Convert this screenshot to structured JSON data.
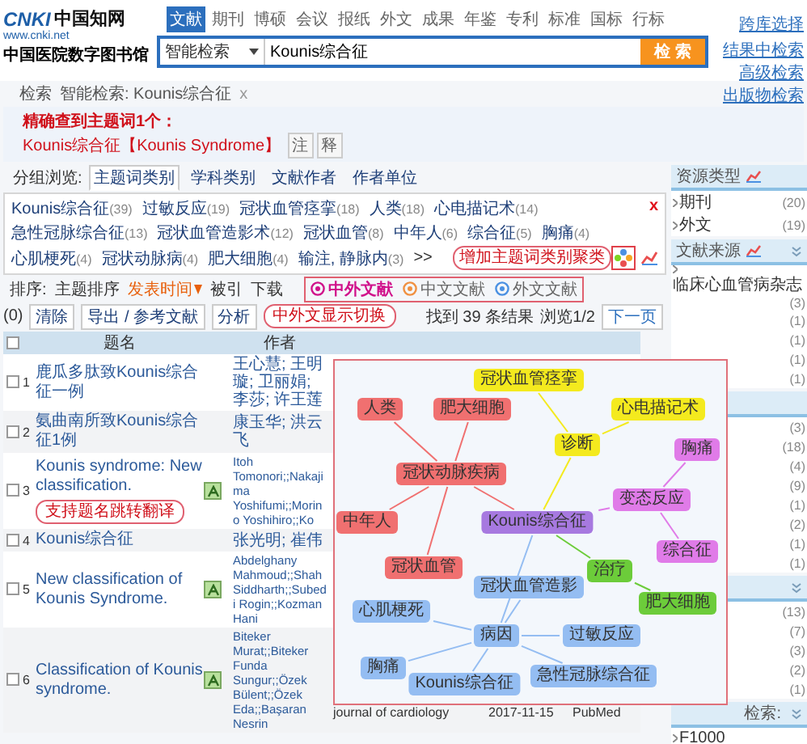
{
  "header": {
    "logo": {
      "mark": "CNKI",
      "name": "中国知网",
      "url": "www.cnki.net",
      "library": "中国医院数字图书馆"
    },
    "nav_tabs": [
      {
        "label": "文献",
        "selected": true
      },
      {
        "label": "期刊",
        "selected": false
      },
      {
        "label": "博硕",
        "selected": false
      },
      {
        "label": "会议",
        "selected": false
      },
      {
        "label": "报纸",
        "selected": false
      },
      {
        "label": "外文",
        "selected": false
      },
      {
        "label": "成果",
        "selected": false
      },
      {
        "label": "年鉴",
        "selected": false
      },
      {
        "label": "专利",
        "selected": false
      },
      {
        "label": "标准",
        "selected": false
      },
      {
        "label": "国标",
        "selected": false
      },
      {
        "label": "行标",
        "selected": false
      }
    ],
    "cross_db_link": "跨库选择",
    "search": {
      "mode": "智能检索",
      "value": "Kounis综合征",
      "button": "检 索"
    },
    "links": [
      "结果中检索",
      "高级检索",
      "出版物检索"
    ]
  },
  "breadcrumb": {
    "items": [
      "检索",
      "智能检索: Kounis综合征"
    ],
    "close": "x"
  },
  "exact_match": {
    "title": "精确查到主题词1个：",
    "term": "Kounis综合征【Kounis Syndrome】",
    "buttons": [
      "注",
      "释"
    ]
  },
  "group_browse": {
    "label": "分组浏览:",
    "tabs": [
      {
        "label": "主题词类别",
        "selected": true
      },
      {
        "label": "学科类别",
        "selected": false
      },
      {
        "label": "文献作者",
        "selected": false
      },
      {
        "label": "作者单位",
        "selected": false
      }
    ],
    "facets": [
      {
        "label": "Kounis综合征",
        "count": "(39)"
      },
      {
        "label": "过敏反应",
        "count": "(19)"
      },
      {
        "label": "冠状血管痉挛",
        "count": "(18)"
      },
      {
        "label": "人类",
        "count": "(18)"
      },
      {
        "label": "心电描记术",
        "count": "(14)"
      },
      {
        "label": "急性冠脉综合征",
        "count": "(13)"
      },
      {
        "label": "冠状血管造影术",
        "count": "(12)"
      },
      {
        "label": "冠状血管",
        "count": "(8)"
      },
      {
        "label": "中年人",
        "count": "(6)"
      },
      {
        "label": "综合征",
        "count": "(5)"
      },
      {
        "label": "胸痛",
        "count": "(4)"
      },
      {
        "label": "心肌梗死",
        "count": "(4)"
      },
      {
        "label": "冠状动脉病",
        "count": "(4)"
      },
      {
        "label": "肥大细胞",
        "count": "(4)"
      },
      {
        "label": "输注, 静脉内",
        "count": "(3)"
      }
    ],
    "more": ">>",
    "close": "x"
  },
  "sort": {
    "label": "排序:",
    "options": [
      {
        "label": "主题排序",
        "selected": false
      },
      {
        "label": "发表时间",
        "selected": true
      },
      {
        "label": "被引",
        "selected": false
      },
      {
        "label": "下载",
        "selected": false
      }
    ]
  },
  "language": [
    {
      "label": "中外文献",
      "selected": true
    },
    {
      "label": "中文文献",
      "selected": false
    },
    {
      "label": "外文文献",
      "selected": false
    }
  ],
  "toolbar": {
    "count": "(0)",
    "buttons": [
      "清除",
      "导出 / 参考文献",
      "分析"
    ]
  },
  "pagination": {
    "found": "找到 39 条结果",
    "page": "浏览1/2",
    "next": "下一页"
  },
  "table": {
    "columns": [
      "题名",
      "作者"
    ],
    "header_checked": false,
    "rows": [
      {
        "checked": false,
        "number": "1",
        "title": "鹿瓜多肽致Kounis综合征一例",
        "translate": false,
        "author": "王心慧; 王明璇; 卫丽娟; 李莎; 许王莲"
      },
      {
        "checked": false,
        "number": "2",
        "title": "氨曲南所致Kounis综合征1例",
        "translate": false,
        "author": "康玉华; 洪云飞"
      },
      {
        "checked": false,
        "number": "3",
        "title": "Kounis syndrome: New classification.",
        "translate": true,
        "author": "Itoh Tomonori;;Nakajima Yoshifumi;;Morino Yoshihiro;;Ko"
      },
      {
        "checked": false,
        "number": "4",
        "title": "Kounis综合征",
        "translate": false,
        "author": "张光明; 崔伟"
      },
      {
        "checked": false,
        "number": "5",
        "title": "New classification of Kounis Syndrome.",
        "translate": true,
        "author": "Abdelghany Mahmoud;;Shah Siddharth;;Subedi Rogin;;Kozman Hani"
      },
      {
        "checked": false,
        "number": "6",
        "title": "Classification of Kounis syndrome.",
        "translate": true,
        "author": "Biteker Murat;;Biteker Funda Sungur;;Özek Bülent;;Özek Eda;;Başaran Nesrin",
        "source": "journal of cardiology",
        "date": "2017-11-15",
        "database": "PubMed"
      }
    ]
  },
  "callouts": [
    "中外文显示切换",
    "增加主题词类别聚类",
    "支持题名跳转翻译"
  ],
  "cluster_graph": {
    "root": {
      "label": "Kounis综合征",
      "color": "#a779e0",
      "children": [
        {
          "label": "诊断",
          "color": "#f4ea1e",
          "children": [
            {
              "label": "冠状血管痉挛",
              "color": "#f4ea1e"
            },
            {
              "label": "心电描记术",
              "color": "#f4ea1e"
            }
          ]
        },
        {
          "label": "冠状动脉疾病",
          "color": "#f07070",
          "children": [
            {
              "label": "人类",
              "color": "#f07070"
            },
            {
              "label": "肥大细胞",
              "color": "#f07070"
            },
            {
              "label": "中年人",
              "color": "#f07070"
            },
            {
              "label": "冠状血管",
              "color": "#f07070"
            }
          ]
        },
        {
          "label": "变态反应",
          "color": "#e07be8",
          "children": [
            {
              "label": "胸痛",
              "color": "#e07be8"
            },
            {
              "label": "综合征",
              "color": "#e07be8"
            }
          ]
        },
        {
          "label": "治疗",
          "color": "#6ccc3a",
          "children": [
            {
              "label": "肥大细胞",
              "color": "#6ccc3a"
            }
          ]
        },
        {
          "label": "病因",
          "color": "#94bdf2",
          "children": [
            {
              "label": "冠状血管造影",
              "color": "#94bdf2"
            },
            {
              "label": "心肌梗死",
              "color": "#94bdf2"
            },
            {
              "label": "过敏反应",
              "color": "#94bdf2"
            },
            {
              "label": "胸痛",
              "color": "#94bdf2"
            },
            {
              "label": "急性冠脉综合征",
              "color": "#94bdf2"
            },
            {
              "label": "Kounis综合征",
              "color": "#94bdf2"
            }
          ]
        }
      ]
    }
  },
  "sidebar": {
    "sections": [
      {
        "title": "资源类型",
        "chart": true,
        "collapse": false,
        "items": [
          {
            "label": "期刊",
            "count": "(20)"
          },
          {
            "label": "外文",
            "count": "(19)"
          }
        ]
      },
      {
        "title": "文献来源",
        "chart": true,
        "collapse": true,
        "items": [
          {
            "label": "临床心血管病杂志",
            "count": "(3)"
          },
          {
            "count": "(1)"
          },
          {
            "count": "(1)"
          },
          {
            "count": "(1)"
          },
          {
            "count": "(1)"
          }
        ]
      },
      {
        "collapse": false,
        "items": [
          {
            "count": "(3)"
          },
          {
            "count": "(18)"
          },
          {
            "count": "(4)"
          },
          {
            "count": "(9)"
          },
          {
            "count": "(1)"
          },
          {
            "count": "(2)"
          },
          {
            "count": "(1)"
          },
          {
            "count": "(1)"
          }
        ]
      },
      {
        "collapse": true,
        "items": [
          {
            "count": "(13)"
          },
          {
            "count": "(7)"
          },
          {
            "count": "(3)"
          },
          {
            "count": "(2)"
          },
          {
            "count": "(1)"
          }
        ]
      },
      {
        "title": "检索:",
        "chart": false,
        "collapse": true,
        "items": [
          {
            "label": "F1000"
          }
        ]
      }
    ]
  }
}
